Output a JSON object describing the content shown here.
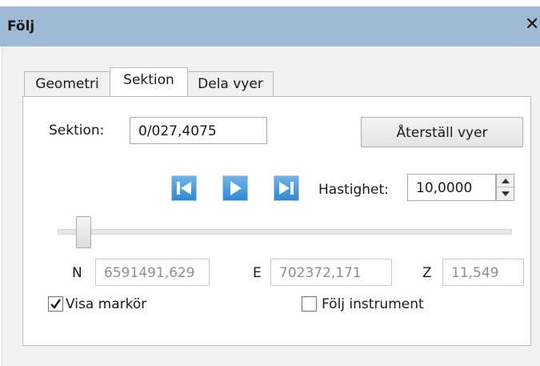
{
  "window": {
    "title": "Följ",
    "close_glyph": "✕"
  },
  "tabs": [
    {
      "label": "Geometri",
      "active": false
    },
    {
      "label": "Sektion",
      "active": true
    },
    {
      "label": "Dela vyer",
      "active": false
    }
  ],
  "section": {
    "label": "Sektion:",
    "value": "0/027,4075"
  },
  "reset_button": {
    "label": "Återställ vyer"
  },
  "playback": {
    "icons": [
      "skip-to-start-icon",
      "play-icon",
      "skip-to-end-icon"
    ],
    "accent": "#2f88d6"
  },
  "speed": {
    "label": "Hastighet:",
    "value": "10,0000"
  },
  "slider": {
    "position_fraction": 0.04
  },
  "coordinates": {
    "n_label": "N",
    "n_value": "6591491,629",
    "e_label": "E",
    "e_value": "702372,171",
    "z_label": "Z",
    "z_value": "11,549"
  },
  "show_markers": {
    "label": "Visa markör",
    "checked": true
  },
  "follow_instrument": {
    "label": "Följ instrument",
    "checked": false
  }
}
